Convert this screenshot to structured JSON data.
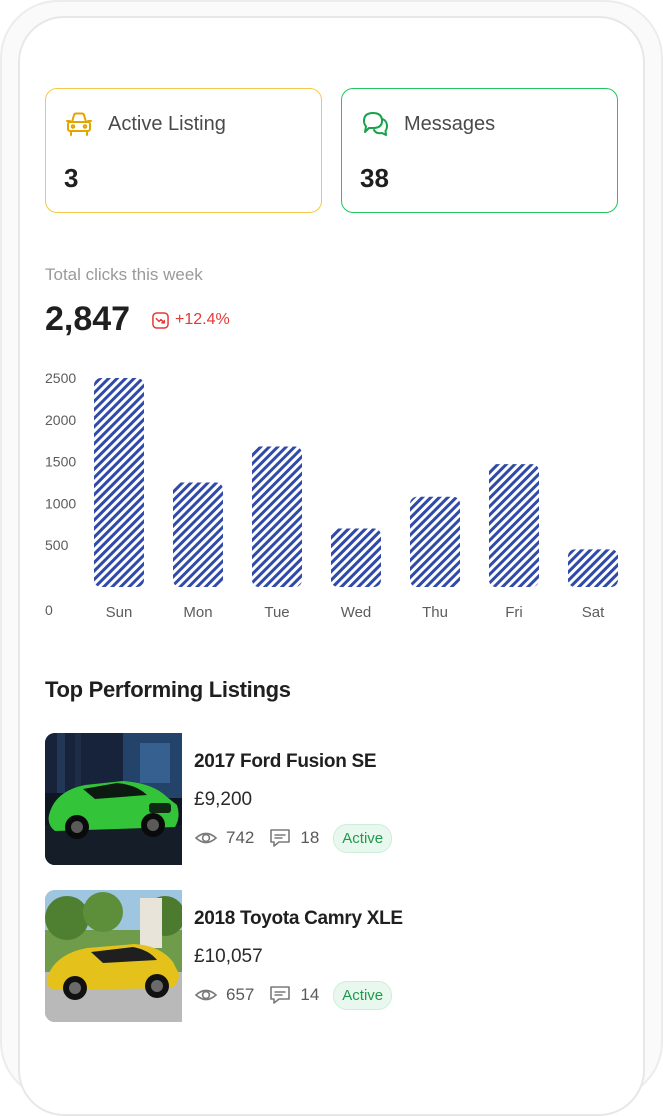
{
  "summary": {
    "active_listing": {
      "label": "Active Listing",
      "value": "3",
      "icon": "car-icon",
      "color": "#e2a600"
    },
    "messages": {
      "label": "Messages",
      "value": "38",
      "icon": "chat-bubbles-icon",
      "color": "#16a34a"
    }
  },
  "clicks": {
    "label": "Total clicks this week",
    "value": "2,847",
    "change": "+12.4%",
    "change_icon": "trend-down-icon",
    "change_color": "#e53935"
  },
  "chart_data": {
    "type": "bar",
    "categories": [
      "Sun",
      "Mon",
      "Tue",
      "Wed",
      "Thu",
      "Fri",
      "Sat"
    ],
    "values": [
      2500,
      1250,
      1680,
      700,
      1080,
      1470,
      450
    ],
    "y_ticks": [
      "2500",
      "2000",
      "1500",
      "1000",
      "500",
      "0"
    ],
    "ylim": [
      0,
      2500
    ],
    "bar_style": "diagonal-stripes",
    "bar_color": "#2f4aa8",
    "grid": false
  },
  "top_listings": {
    "title": "Top Performing Listings",
    "items": [
      {
        "title": "2017 Ford Fusion SE",
        "price": "£9,200",
        "views": "742",
        "messages": "18",
        "status": "Active"
      },
      {
        "title": "2018 Toyota Camry XLE",
        "price": "£10,057",
        "views": "657",
        "messages": "14",
        "status": "Active"
      }
    ]
  }
}
